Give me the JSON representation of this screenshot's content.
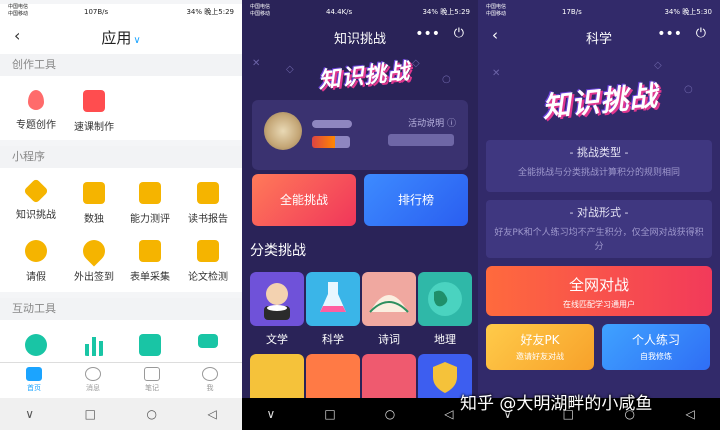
{
  "phone1": {
    "status": {
      "carrier": "中国电信 中国移动",
      "speed": "107B/s",
      "battery": "34%",
      "time": "晚上5:29"
    },
    "header": {
      "back_icon": "chevron-left-icon",
      "title": "应用",
      "title_chevron": "chevron-down-icon"
    },
    "sections": [
      {
        "title": "创作工具",
        "items": [
          {
            "label": "专题创作",
            "icon": "balloon-icon",
            "color": "#ff6b6b"
          },
          {
            "label": "速课制作",
            "icon": "video-lesson-icon",
            "color": "#ff4d4f"
          }
        ]
      },
      {
        "title": "小程序",
        "items": [
          {
            "label": "知识挑战",
            "icon": "swords-icon",
            "color": "#f5b400"
          },
          {
            "label": "数独",
            "icon": "sudoku-icon",
            "color": "#f5b400"
          },
          {
            "label": "能力测评",
            "icon": "assessment-icon",
            "color": "#f5b400"
          },
          {
            "label": "读书报告",
            "icon": "report-chart-icon",
            "color": "#f5b400"
          },
          {
            "label": "请假",
            "icon": "clock-icon",
            "color": "#f5b400"
          },
          {
            "label": "外出签到",
            "icon": "location-check-icon",
            "color": "#f5b400"
          },
          {
            "label": "表单采集",
            "icon": "form-icon",
            "color": "#f5b400"
          },
          {
            "label": "论文检测",
            "icon": "paper-check-icon",
            "color": "#f5b400"
          }
        ]
      },
      {
        "title": "互动工具",
        "items": [
          {
            "label": "",
            "icon": "touch-icon",
            "color": "#19c5a5"
          },
          {
            "label": "",
            "icon": "bar-chart-icon",
            "color": "#19c5a5"
          },
          {
            "label": "",
            "icon": "presentation-icon",
            "color": "#19c5a5"
          },
          {
            "label": "",
            "icon": "video-camera-icon",
            "color": "#19c5a5"
          }
        ]
      }
    ],
    "tabs": [
      {
        "label": "首页",
        "icon": "home-icon",
        "active": true
      },
      {
        "label": "消息",
        "icon": "message-icon",
        "active": false
      },
      {
        "label": "笔记",
        "icon": "note-icon",
        "active": false
      },
      {
        "label": "我",
        "icon": "user-icon",
        "active": false
      }
    ]
  },
  "phone2": {
    "status": {
      "carrier": "中国电信 中国移动",
      "speed": "44.4K/s",
      "battery": "34%",
      "time": "晚上5:29"
    },
    "header": {
      "title": "知识挑战",
      "more_icon": "more-dots-icon",
      "power_icon": "power-icon"
    },
    "logo": "知识挑战",
    "profile": {
      "activity_link": "活动说明",
      "info_icon": "info-icon"
    },
    "buttons": {
      "all": "全能挑战",
      "rank": "排行榜"
    },
    "category_title": "分类挑战",
    "categories": [
      {
        "label": "文学",
        "color": "#6f52d9"
      },
      {
        "label": "科学",
        "color": "#3ab5e8"
      },
      {
        "label": "诗词",
        "color": "#f0a8a0"
      },
      {
        "label": "地理",
        "color": "#2fb8a8"
      }
    ],
    "categories_row2_colors": [
      "#f5c23a",
      "#ff7a45",
      "#ef5a6f",
      "#3d5ef0"
    ]
  },
  "phone3": {
    "status": {
      "carrier": "中国电信 中国移动",
      "speed": "17B/s",
      "battery": "34%",
      "time": "晚上5:30"
    },
    "header": {
      "back_icon": "chevron-left-icon",
      "title": "科学",
      "more_icon": "more-dots-icon",
      "power_icon": "power-icon"
    },
    "logo": "知识挑战",
    "type_box": {
      "heading": "- 挑战类型 -",
      "desc": "全能挑战与分类挑战计算积分的规则相同"
    },
    "form_box": {
      "heading": "- 对战形式 -",
      "desc": "好友PK和个人练习均不产生积分，仅全网对战获得积分"
    },
    "main_button": {
      "title": "全网对战",
      "sub": "在线匹配学习通用户"
    },
    "friend_button": {
      "title": "好友PK",
      "sub": "邀请好友对战"
    },
    "practice_button": {
      "title": "个人练习",
      "sub": "自我修炼"
    }
  },
  "system_nav": {
    "back": "◁",
    "home": "○",
    "recent": "□",
    "down": "∨"
  },
  "watermark": "知乎 @大明湖畔的小咸鱼"
}
